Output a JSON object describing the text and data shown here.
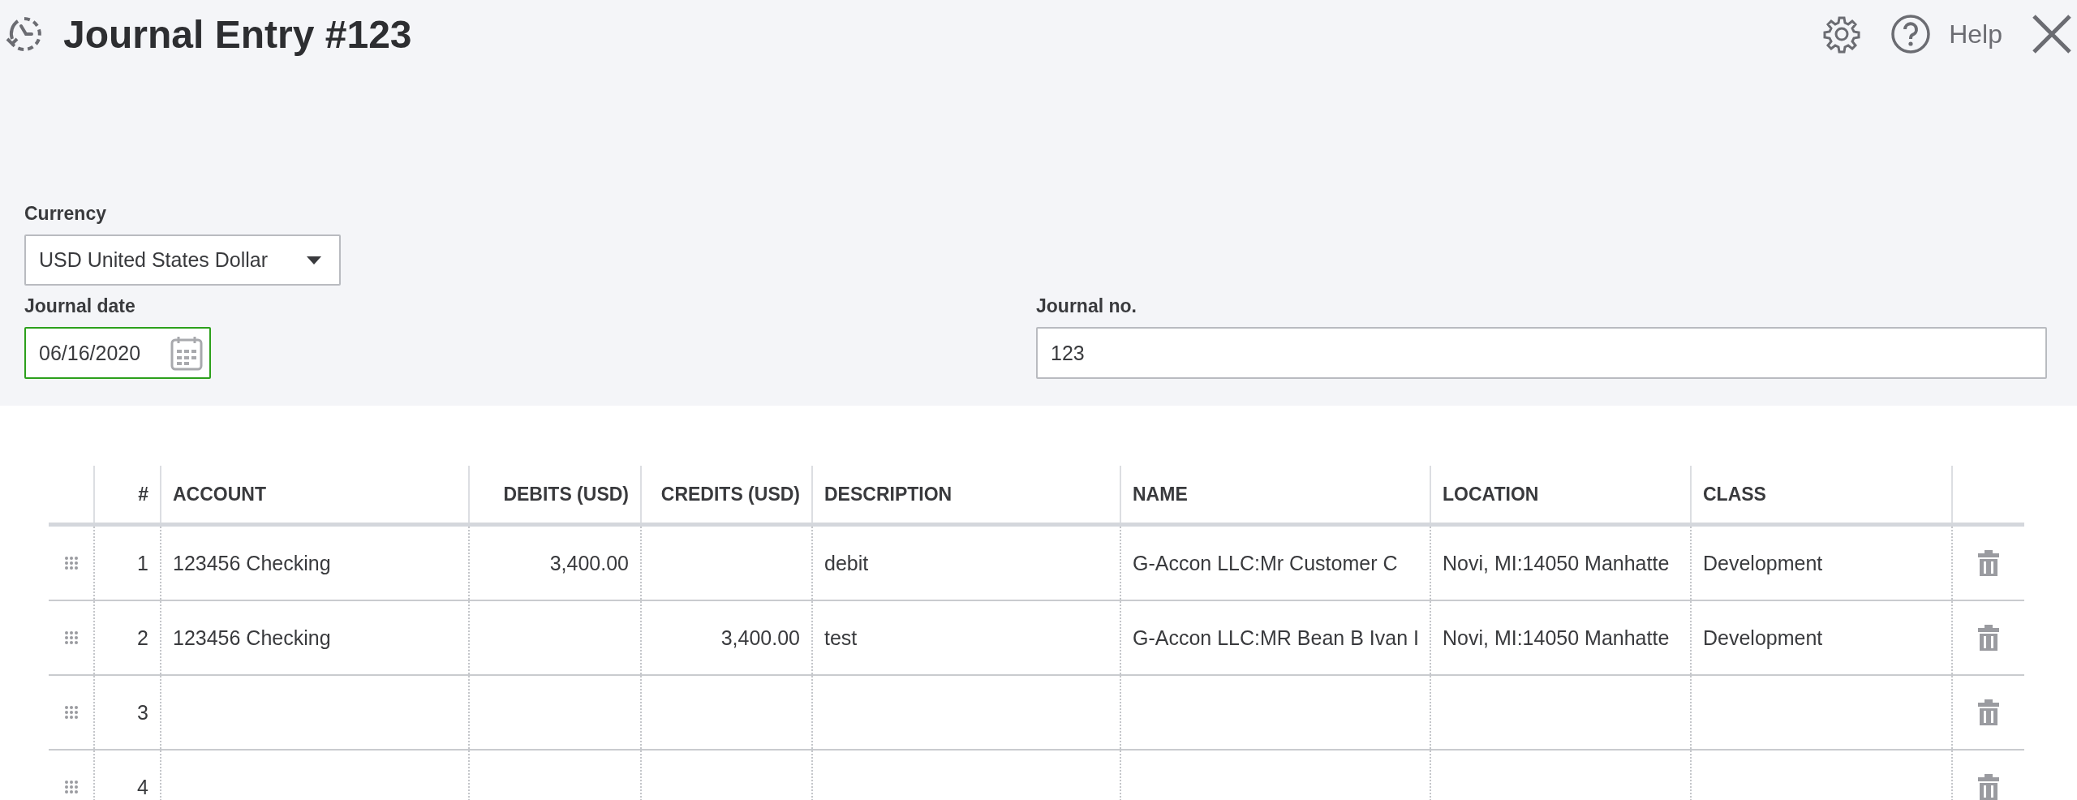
{
  "header": {
    "title": "Journal Entry #123",
    "help": "Help"
  },
  "form": {
    "currency": {
      "label": "Currency",
      "value": "USD United States Dollar"
    },
    "journal_date": {
      "label": "Journal date",
      "value": "06/16/2020",
      "focused": true
    },
    "journal_no": {
      "label": "Journal no.",
      "value": "123"
    }
  },
  "table": {
    "columns": [
      "#",
      "ACCOUNT",
      "DEBITS (USD)",
      "CREDITS (USD)",
      "DESCRIPTION",
      "NAME",
      "LOCATION",
      "CLASS"
    ],
    "rows": [
      {
        "line": "1",
        "account": "123456 Checking",
        "debits": "3,400.00",
        "credits": "",
        "description": "debit",
        "name": "G-Accon LLC:Mr Customer C",
        "location": "Novi, MI:14050 Manhatte",
        "class": "Development"
      },
      {
        "line": "2",
        "account": "123456 Checking",
        "debits": "",
        "credits": "3,400.00",
        "description": "test",
        "name": "G-Accon LLC:MR Bean B Ivan I",
        "location": "Novi, MI:14050 Manhatte",
        "class": "Development"
      },
      {
        "line": "3",
        "account": "",
        "debits": "",
        "credits": "",
        "description": "",
        "name": "",
        "location": "",
        "class": ""
      },
      {
        "line": "4",
        "account": "",
        "debits": "",
        "credits": "",
        "description": "",
        "name": "",
        "location": "",
        "class": ""
      }
    ]
  }
}
